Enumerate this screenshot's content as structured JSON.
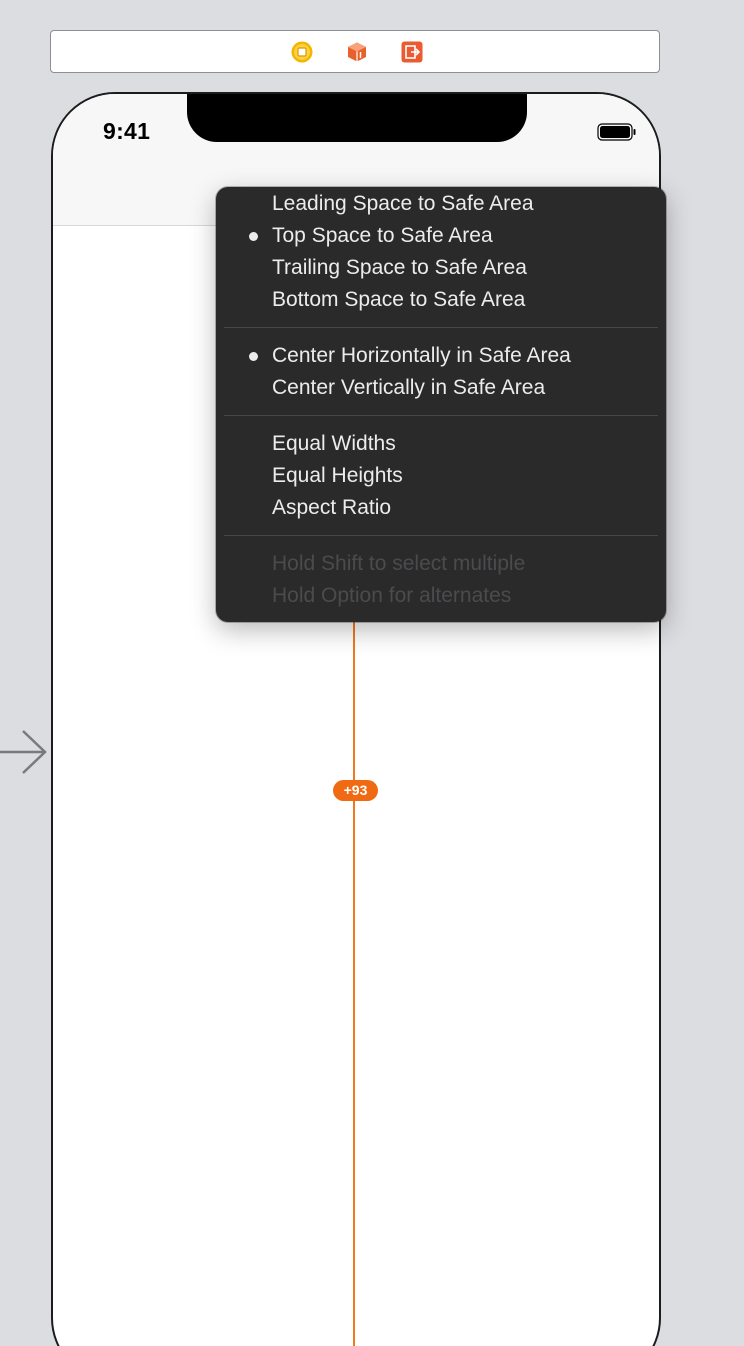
{
  "dock": {
    "icons": [
      "view-controller-icon",
      "first-responder-icon",
      "exit-icon"
    ],
    "colors": {
      "view_controller": "#f5b400",
      "first_responder": "#e8602a",
      "exit": "#ec5b2f"
    }
  },
  "phone": {
    "status_time": "9:41"
  },
  "constraint": {
    "badge_value": "+93",
    "color": "#f0781e"
  },
  "menu": {
    "items": [
      {
        "label": "Leading Space to Safe Area",
        "checked": false,
        "enabled": true
      },
      {
        "label": "Top Space to Safe Area",
        "checked": true,
        "enabled": true
      },
      {
        "label": "Trailing Space to Safe Area",
        "checked": false,
        "enabled": true
      },
      {
        "label": "Bottom Space to Safe Area",
        "checked": false,
        "enabled": true
      },
      {
        "label": "Center Horizontally in Safe Area",
        "checked": true,
        "enabled": true
      },
      {
        "label": "Center Vertically in Safe Area",
        "checked": false,
        "enabled": true
      },
      {
        "label": "Equal Widths",
        "checked": false,
        "enabled": true
      },
      {
        "label": "Equal Heights",
        "checked": false,
        "enabled": true
      },
      {
        "label": "Aspect Ratio",
        "checked": false,
        "enabled": true
      }
    ],
    "hints": [
      "Hold Shift to select multiple",
      "Hold Option for alternates"
    ]
  }
}
